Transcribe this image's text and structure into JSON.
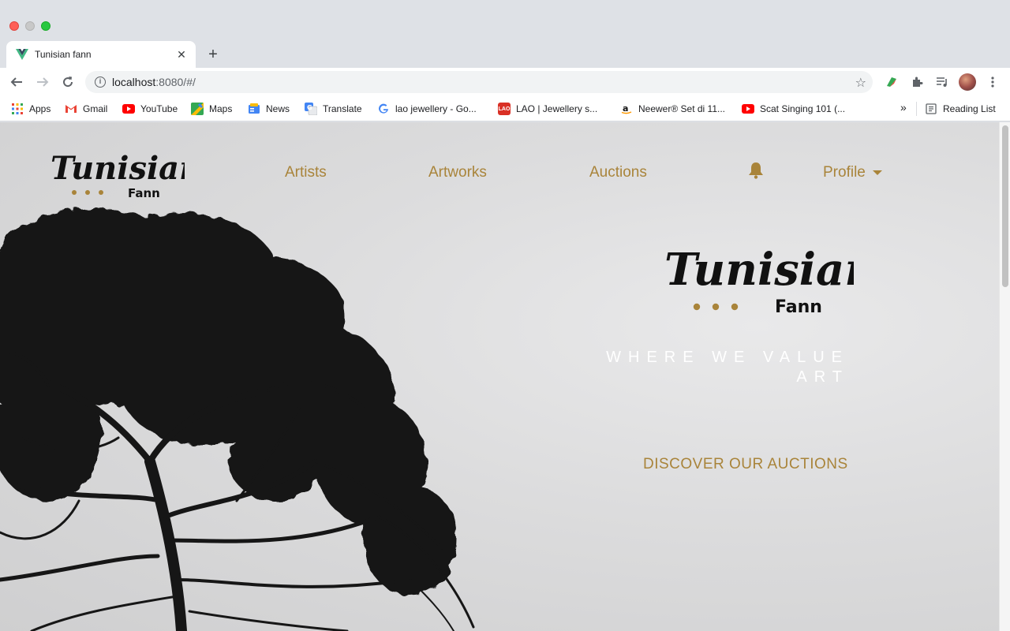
{
  "browser": {
    "tab": {
      "title": "Tunisian fann"
    },
    "address_bar": {
      "host": "localhost",
      "rest": ":8080/#/"
    },
    "bookmarks": [
      {
        "label": "Apps",
        "icon": "apps-grid-icon"
      },
      {
        "label": "Gmail",
        "icon": "gmail-icon"
      },
      {
        "label": "YouTube",
        "icon": "youtube-icon"
      },
      {
        "label": "Maps",
        "icon": "maps-icon"
      },
      {
        "label": "News",
        "icon": "news-icon"
      },
      {
        "label": "Translate",
        "icon": "translate-icon"
      },
      {
        "label": "lao jewellery - Go...",
        "icon": "google-icon"
      },
      {
        "label": "LAO | Jewellery s...",
        "icon": "lao-icon"
      },
      {
        "label": "Neewer® Set di 11...",
        "icon": "amazon-icon"
      },
      {
        "label": "Scat Singing 101 (...",
        "icon": "youtube-icon"
      }
    ],
    "more_bookmarks": "»",
    "reading_list": "Reading List"
  },
  "site": {
    "logo": {
      "word": "Tunisian",
      "sub": "Fann"
    },
    "nav": [
      "Artists",
      "Artworks",
      "Auctions"
    ],
    "profile_label": "Profile",
    "hero": {
      "tagline_line1": "WHERE WE VALUE",
      "tagline_line2": "ART",
      "cta": "DISCOVER OUR AUCTIONS"
    }
  },
  "colors": {
    "accent": "#a9843a",
    "tab_bg": "#dee1e6"
  }
}
